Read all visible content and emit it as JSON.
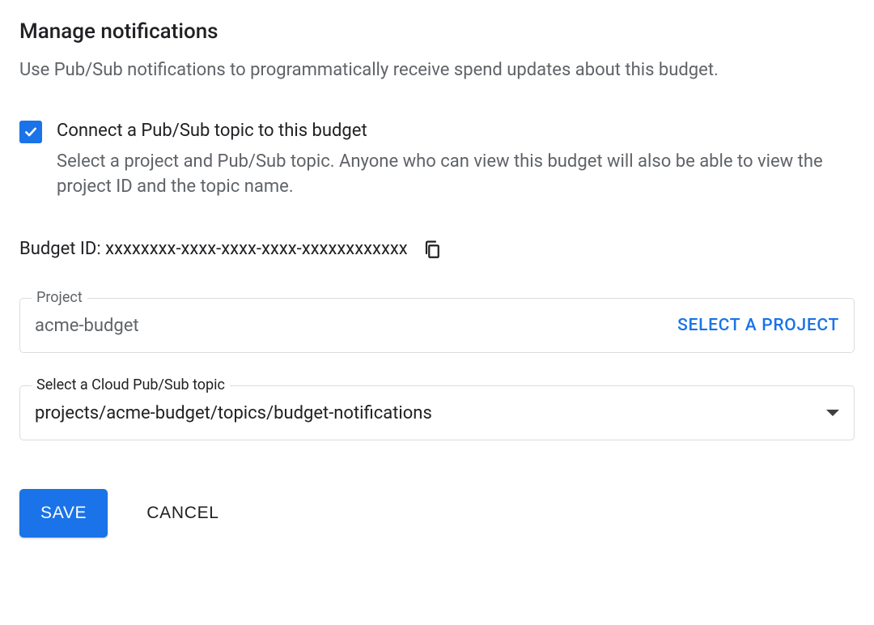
{
  "header": {
    "title": "Manage notifications",
    "description": "Use Pub/Sub notifications to programmatically receive spend updates about this budget."
  },
  "pubsub_checkbox": {
    "checked": true,
    "label": "Connect a Pub/Sub topic to this budget",
    "hint": "Select a project and Pub/Sub topic. Anyone who can view this budget will also be able to view the project ID and the topic name."
  },
  "budget_id": {
    "label": "Budget ID: ",
    "value": "xxxxxxxx-xxxx-xxxx-xxxx-xxxxxxxxxxxx"
  },
  "project_field": {
    "label": "Project",
    "value": "acme-budget",
    "action": "SELECT A PROJECT"
  },
  "topic_field": {
    "label": "Select a Cloud Pub/Sub topic",
    "value": "projects/acme-budget/topics/budget-notifications"
  },
  "buttons": {
    "save": "SAVE",
    "cancel": "CANCEL"
  }
}
